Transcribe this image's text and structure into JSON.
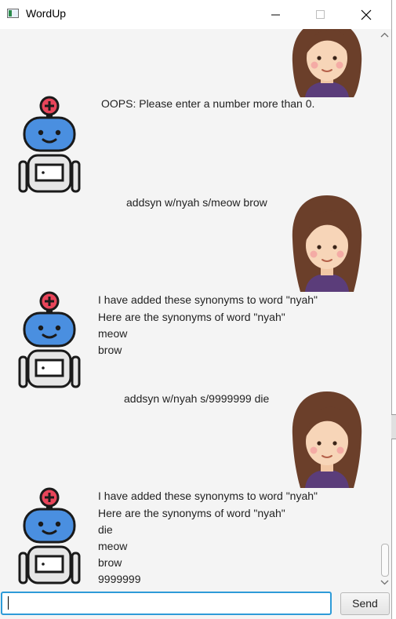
{
  "window": {
    "title": "WordUp",
    "minimize_glyph": "—",
    "maximize_glyph": "☐",
    "close_glyph": "✕"
  },
  "messages": [
    {
      "sender": "user",
      "text": ""
    },
    {
      "sender": "bot",
      "lines": [
        "OOPS: Please enter a number more than 0."
      ]
    },
    {
      "sender": "user",
      "text": "addsyn w/nyah s/meow brow"
    },
    {
      "sender": "bot",
      "lines": [
        "I have added these synonyms to word \"nyah\"",
        "Here are the synonyms of word \"nyah\"",
        "meow",
        "brow"
      ]
    },
    {
      "sender": "user",
      "text": "addsyn w/nyah s/9999999 die"
    },
    {
      "sender": "bot",
      "lines": [
        "I have added these synonyms to word \"nyah\"",
        "Here are the synonyms of word \"nyah\"",
        "die",
        "meow",
        "brow",
        "9999999"
      ]
    }
  ],
  "input": {
    "value": "",
    "placeholder": ""
  },
  "send_label": "Send",
  "colors": {
    "input_focus": "#2e9bd8",
    "chat_background": "#f4f4f4",
    "bot_head": "#4a8fe0",
    "bot_badge": "#e8455a",
    "user_hair": "#6b3f2a",
    "user_shirt": "#5b3d7a"
  },
  "icons": {
    "bot_avatar": "robot-icon",
    "user_avatar": "woman-avatar-icon",
    "app_icon": "window-app-icon"
  }
}
